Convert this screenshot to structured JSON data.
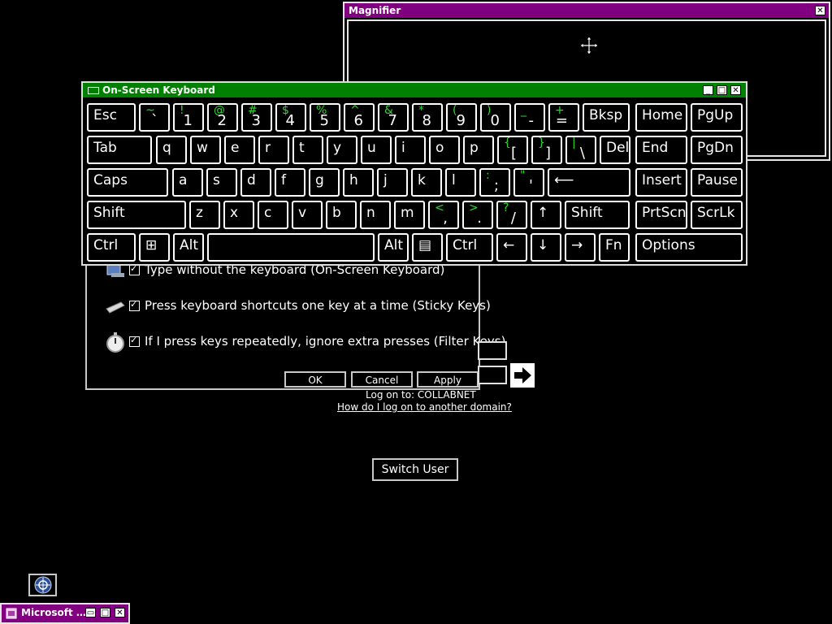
{
  "magnifier": {
    "title": "Magnifier",
    "close_glyph": "✕",
    "move_icon": "move-cursor-icon"
  },
  "ease_dialog": {
    "options": [
      {
        "icon": "keyboard-icon",
        "checked": true,
        "label": "Type without the keyboard (On-Screen Keyboard)"
      },
      {
        "icon": "sticky-keys-icon",
        "checked": true,
        "label": "Press keyboard shortcuts one key at a time (Sticky Keys)"
      },
      {
        "icon": "stopwatch-icon",
        "checked": true,
        "label": "If I press keys repeatedly, ignore extra presses (Filter Keys)"
      }
    ],
    "buttons": {
      "ok": "OK",
      "cancel": "Cancel",
      "apply": "Apply"
    }
  },
  "logon": {
    "log_on_to": "Log on to: COLLABNET",
    "other_domain_link": "How do I log on to another domain?",
    "switch_user": "Switch User"
  },
  "osk": {
    "title": "On-Screen Keyboard",
    "controls": {
      "minimize": "_",
      "maximize": "□",
      "close": "✕"
    },
    "keys": [
      {
        "id": "esc",
        "main": "Esc"
      },
      {
        "id": "backtick",
        "shift": "~",
        "base": "`"
      },
      {
        "id": "1",
        "shift": "!",
        "base": "1"
      },
      {
        "id": "2",
        "shift": "@",
        "base": "2"
      },
      {
        "id": "3",
        "shift": "#",
        "base": "3"
      },
      {
        "id": "4",
        "shift": "$",
        "base": "4"
      },
      {
        "id": "5",
        "shift": "%",
        "base": "5"
      },
      {
        "id": "6",
        "shift": "^",
        "base": "6"
      },
      {
        "id": "7",
        "shift": "&",
        "base": "7"
      },
      {
        "id": "8",
        "shift": "*",
        "base": "8"
      },
      {
        "id": "9",
        "shift": "(",
        "base": "9"
      },
      {
        "id": "0",
        "shift": ")",
        "base": "0"
      },
      {
        "id": "minus",
        "shift": "_",
        "base": "-"
      },
      {
        "id": "equals",
        "shift": "+",
        "base": "="
      },
      {
        "id": "bksp",
        "main": "Bksp"
      },
      {
        "id": "home",
        "main": "Home"
      },
      {
        "id": "pgup",
        "main": "PgUp"
      },
      {
        "id": "tab",
        "main": "Tab"
      },
      {
        "id": "q",
        "main": "q"
      },
      {
        "id": "w",
        "main": "w"
      },
      {
        "id": "e",
        "main": "e"
      },
      {
        "id": "r",
        "main": "r"
      },
      {
        "id": "t",
        "main": "t"
      },
      {
        "id": "y",
        "main": "y"
      },
      {
        "id": "u",
        "main": "u"
      },
      {
        "id": "i",
        "main": "i"
      },
      {
        "id": "o",
        "main": "o"
      },
      {
        "id": "p",
        "main": "p"
      },
      {
        "id": "lbracket",
        "shift": "{",
        "base": "["
      },
      {
        "id": "rbracket",
        "shift": "}",
        "base": "]"
      },
      {
        "id": "backslash",
        "shift": "|",
        "base": "\\"
      },
      {
        "id": "del",
        "main": "Del"
      },
      {
        "id": "end",
        "main": "End"
      },
      {
        "id": "pgdn",
        "main": "PgDn"
      },
      {
        "id": "caps",
        "main": "Caps"
      },
      {
        "id": "a",
        "main": "a"
      },
      {
        "id": "s",
        "main": "s"
      },
      {
        "id": "d",
        "main": "d"
      },
      {
        "id": "f",
        "main": "f"
      },
      {
        "id": "g",
        "main": "g"
      },
      {
        "id": "h",
        "main": "h"
      },
      {
        "id": "j",
        "main": "j"
      },
      {
        "id": "k",
        "main": "k"
      },
      {
        "id": "l",
        "main": "l"
      },
      {
        "id": "semicolon",
        "shift": ":",
        "base": ";"
      },
      {
        "id": "quote",
        "shift": "\"",
        "base": "'"
      },
      {
        "id": "enter",
        "main": "⟵"
      },
      {
        "id": "insert",
        "main": "Insert"
      },
      {
        "id": "pause",
        "main": "Pause"
      },
      {
        "id": "lshift",
        "main": "Shift"
      },
      {
        "id": "z",
        "main": "z"
      },
      {
        "id": "x",
        "main": "x"
      },
      {
        "id": "c",
        "main": "c"
      },
      {
        "id": "v",
        "main": "v"
      },
      {
        "id": "b",
        "main": "b"
      },
      {
        "id": "n",
        "main": "n"
      },
      {
        "id": "m",
        "main": "m"
      },
      {
        "id": "comma",
        "shift": "<",
        "base": ","
      },
      {
        "id": "period",
        "shift": ">",
        "base": "."
      },
      {
        "id": "slash",
        "shift": "?",
        "base": "/"
      },
      {
        "id": "up",
        "main": "↑"
      },
      {
        "id": "rshift",
        "main": "Shift"
      },
      {
        "id": "prtscn",
        "main": "PrtScn"
      },
      {
        "id": "scrlk",
        "main": "ScrLk"
      },
      {
        "id": "lctrl",
        "main": "Ctrl"
      },
      {
        "id": "win",
        "main": "⊞"
      },
      {
        "id": "lalt",
        "main": "Alt"
      },
      {
        "id": "space",
        "main": ""
      },
      {
        "id": "ralt",
        "main": "Alt"
      },
      {
        "id": "menu",
        "main": "▤"
      },
      {
        "id": "rctrl",
        "main": "Ctrl"
      },
      {
        "id": "left",
        "main": "←"
      },
      {
        "id": "down",
        "main": "↓"
      },
      {
        "id": "right",
        "main": "→"
      },
      {
        "id": "fn",
        "main": "Fn"
      },
      {
        "id": "options",
        "main": "Options"
      }
    ]
  },
  "taskbar": {
    "tray_icon": "accessibility-icon",
    "task_label": "Microsoft …",
    "task_controls": {
      "restore": "▭",
      "maximize": "□",
      "close": "✕"
    }
  },
  "colors": {
    "magnifier_title": "#800080",
    "osk_title": "#008000",
    "shift_char": "#2bd92b"
  }
}
